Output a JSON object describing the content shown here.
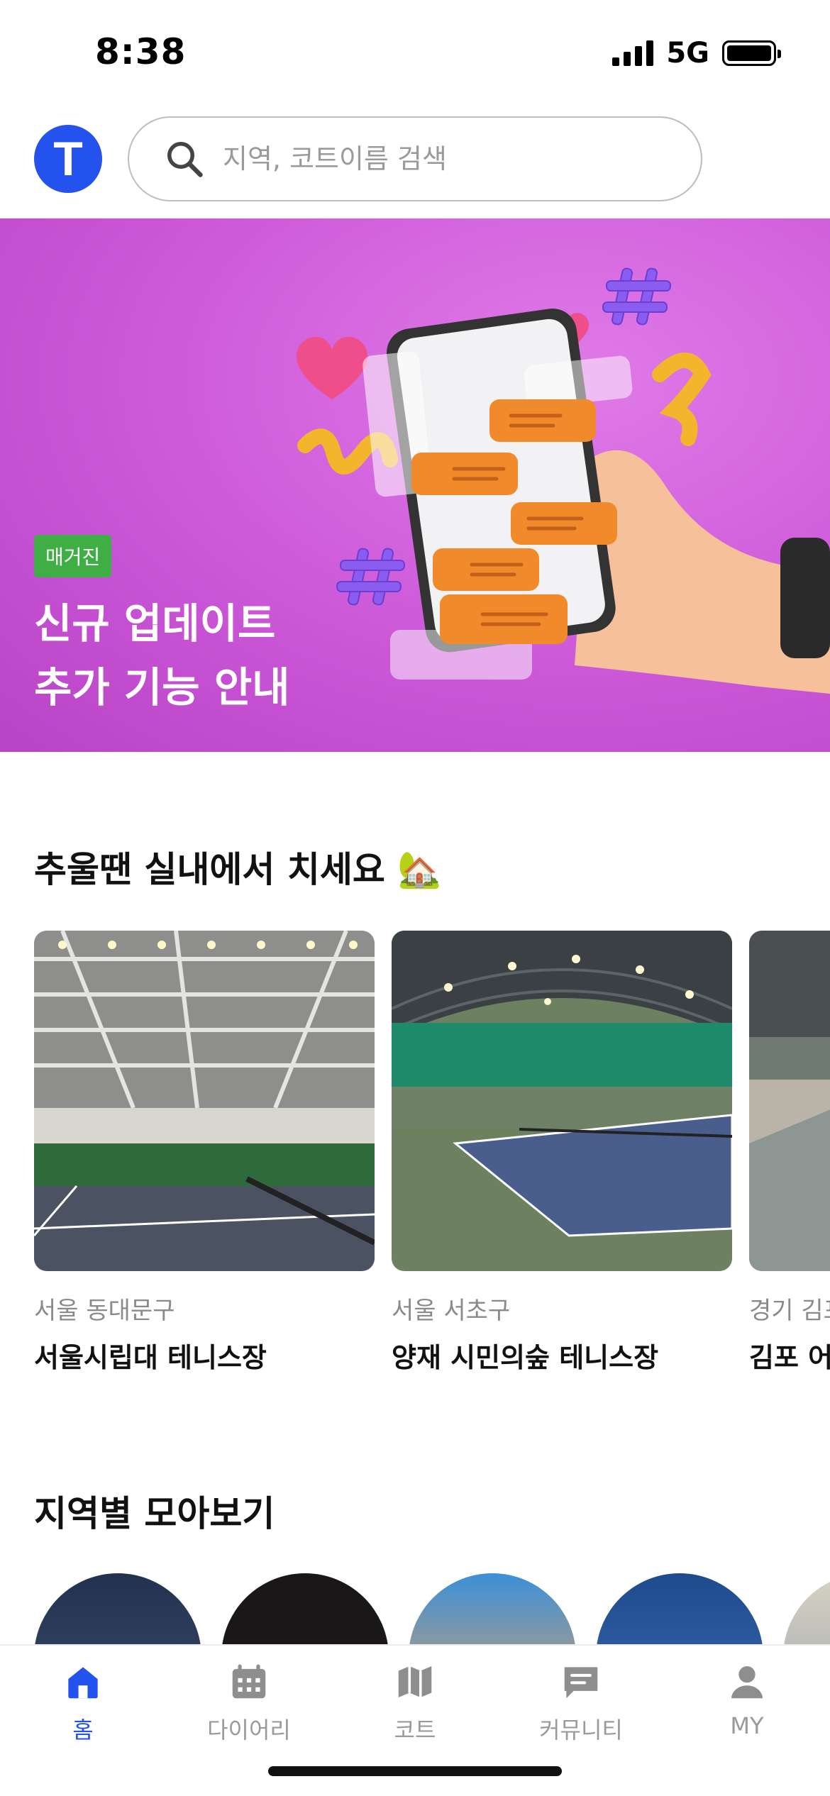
{
  "status_bar": {
    "time": "8:38",
    "network": "5G"
  },
  "header": {
    "logo_letter": "T",
    "search_placeholder": "지역, 코트이름 검색"
  },
  "banner": {
    "badge": "매거진",
    "title_line1": "신규 업데이트",
    "title_line2": "추가 기능 안내"
  },
  "indoor_section": {
    "title": "추울땐 실내에서 치세요 🏡",
    "courts": [
      {
        "region": "서울 동대문구",
        "name": "서울시립대 테니스장"
      },
      {
        "region": "서울 서초구",
        "name": "양재 시민의숲 테니스장"
      },
      {
        "region": "경기 김포",
        "name": "김포 어"
      }
    ]
  },
  "region_section": {
    "title": "지역별 모아보기"
  },
  "tabbar": {
    "items": [
      {
        "label": "홈",
        "icon": "home-icon",
        "active": true
      },
      {
        "label": "다이어리",
        "icon": "calendar-icon",
        "active": false
      },
      {
        "label": "코트",
        "icon": "map-icon",
        "active": false
      },
      {
        "label": "커뮤니티",
        "icon": "chat-icon",
        "active": false
      },
      {
        "label": "MY",
        "icon": "person-icon",
        "active": false
      }
    ]
  },
  "colors": {
    "brand_blue": "#2452ef",
    "banner_purple": "#d063dc",
    "badge_green": "#3fae45",
    "inactive_gray": "#9a9a9a"
  }
}
